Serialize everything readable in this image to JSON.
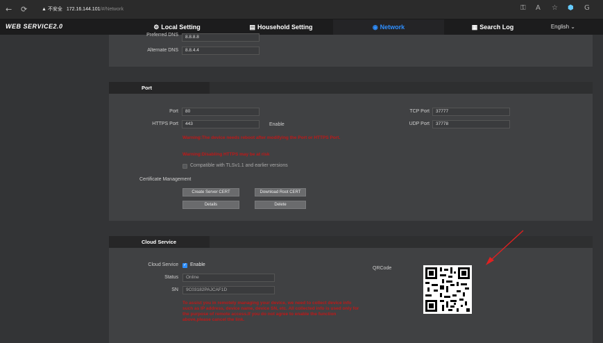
{
  "browser": {
    "back_icon": "←",
    "refresh_icon": "⟳",
    "warn_label": "▲ 不安全",
    "host": "172.16.144.101",
    "path": "/#/Network"
  },
  "topnav": {
    "brand": "WEB SERVICE2.0",
    "tabs": [
      {
        "label": "Local Setting",
        "icon": "gear-icon"
      },
      {
        "label": "Household Setting",
        "icon": "building-icon"
      },
      {
        "label": "Network",
        "icon": "globe-icon"
      },
      {
        "label": "Search Log",
        "icon": "log-icon"
      }
    ],
    "language": "English ⌄",
    "accent": "#2f8fff"
  },
  "dns": {
    "preferred_label": "Preferred DNS",
    "preferred_value": "8.8.8.8",
    "alternate_label": "Alternate DNS",
    "alternate_value": "8.8.4.4"
  },
  "port": {
    "title": "Port",
    "port_label": "Port",
    "port_value": "80",
    "https_label": "HTTPS Port",
    "https_value": "443",
    "enable_label": "Enable",
    "tcp_label": "TCP Port",
    "tcp_value": "37777",
    "udp_label": "UDP Port",
    "udp_value": "37778",
    "warning1": "Warning:The device needs reboot after modifying the Port or HTTPS Port.",
    "warning2": "Warning:Disabling HTTPS may be at risk",
    "tls_label": "Compatible with TLSv1.1 and earlier versions",
    "cert_label": "Certificate Management",
    "btn_create": "Create Server CERT",
    "btn_download": "Download Root CERT",
    "btn_details": "Details",
    "btn_delete": "Delete"
  },
  "cloud": {
    "title": "Cloud Service",
    "service_label": "Cloud Service",
    "enable_label": "Enable",
    "status_label": "Status",
    "status_value": "Online",
    "sn_label": "SN",
    "sn_value": "9C03182PAJCAF1D",
    "qrcode_label": "QRCode",
    "notice": "To assist you in remotely managing your device, we need to collect device info such as IP address, device name, device SN, etc. All collected info is used only for the purpose of remote access.If you do not agree to enable the function above,please cancel the link."
  },
  "colors": {
    "warning_red": "#c01818",
    "annotation_arrow": "#e02020",
    "checkbox_blue": "#2f8fff"
  }
}
